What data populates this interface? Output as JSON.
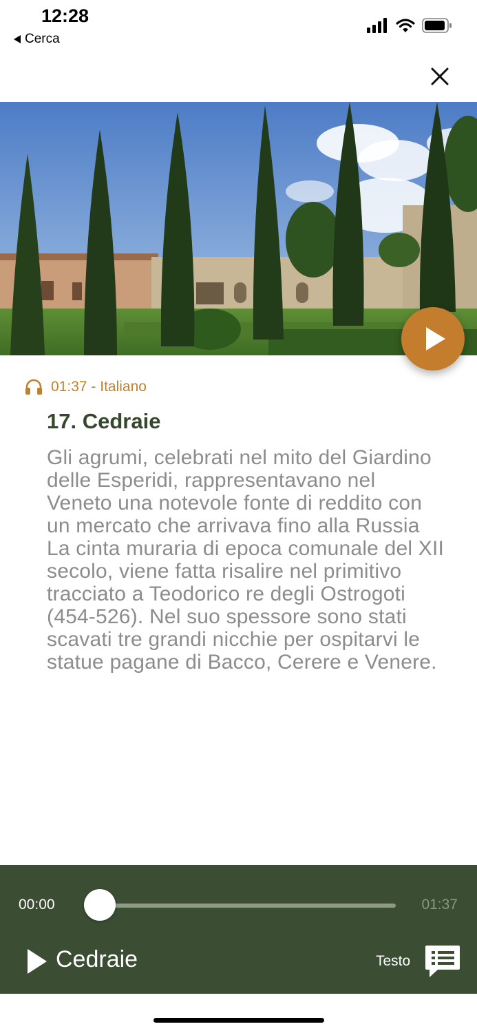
{
  "status": {
    "time": "12:28",
    "back_label": "Cerca"
  },
  "audio_meta": {
    "duration": "01:37",
    "separator": " - ",
    "language": "Italiano"
  },
  "stop": {
    "title": "17. Cedraie",
    "description": "Gli agrumi, celebrati nel mito del Giardino delle Esperidi, rappresentavano nel Veneto una notevole fonte di reddito con un mercato che arrivava fino alla Russia La cinta muraria di epoca comunale del XII secolo, viene fatta risalire nel primitivo tracciato a Teodorico re degli Ostrogoti (454-526). Nel suo spessore sono stati scavati tre grandi nicchie per ospitarvi le statue pagane di Bacco, Cerere e Venere."
  },
  "player": {
    "current_time": "00:00",
    "total_time": "01:37",
    "progress": 0,
    "track_name": "Cedraie",
    "text_label": "Testo"
  },
  "colors": {
    "accent": "#c47c2d",
    "title_green": "#35482d",
    "player_bg": "#3b4d33",
    "body_grey": "#8c8c8c"
  },
  "icons": {
    "signal": "cellular-signal-icon",
    "wifi": "wifi-icon",
    "battery": "battery-icon",
    "close": "close-icon",
    "headphones": "headphones-icon",
    "play": "play-icon",
    "transcript": "transcript-icon"
  }
}
